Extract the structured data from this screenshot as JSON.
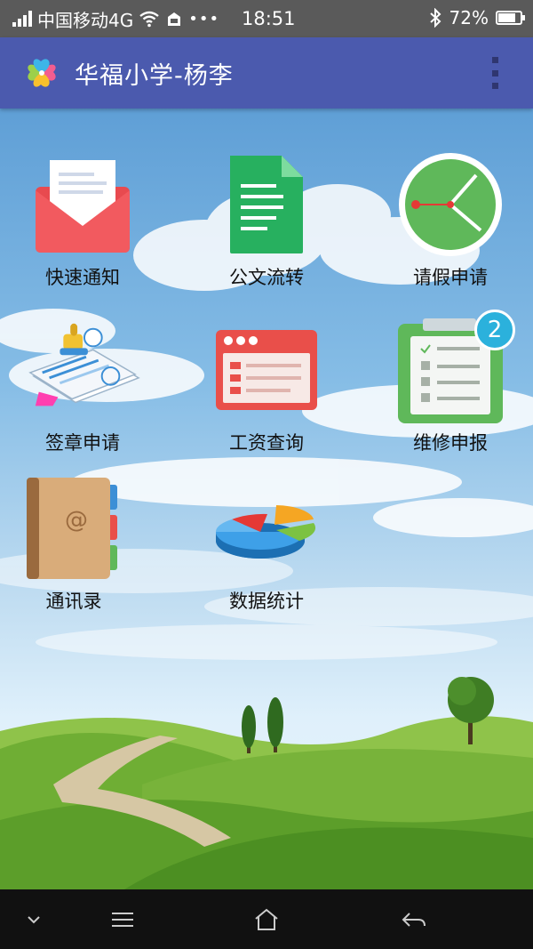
{
  "status_bar": {
    "carrier": "中国移动4G",
    "time": "18:51",
    "battery": "72%",
    "battery_level": 0.72,
    "icons": [
      "signal-icon",
      "wifi-icon",
      "sim-icon",
      "more-icon",
      "bluetooth-icon",
      "battery-icon"
    ]
  },
  "app_bar": {
    "title": "华福小学-杨李",
    "logo": "clover-logo",
    "menu_icon": "overflow-menu-icon"
  },
  "grid": [
    {
      "label": "快速通知",
      "icon": "mail-envelope-icon"
    },
    {
      "label": "公文流转",
      "icon": "document-icon"
    },
    {
      "label": "请假申请",
      "icon": "clock-icon"
    },
    {
      "label": "签章申请",
      "icon": "stamp-icon"
    },
    {
      "label": "工资查询",
      "icon": "browser-window-icon"
    },
    {
      "label": "维修申报",
      "icon": "clipboard-checklist-icon",
      "badge": "2"
    },
    {
      "label": "通讯录",
      "icon": "address-book-icon"
    },
    {
      "label": "数据统计",
      "icon": "pie-chart-icon"
    }
  ],
  "nav_bar": {
    "buttons": [
      "collapse-icon",
      "menu-icon",
      "home-icon",
      "back-icon"
    ]
  },
  "colors": {
    "status_bar_bg": "#5a5a5a",
    "app_bar_bg": "#4b5aae",
    "badge": "#2bb1dc",
    "nav_bar_bg": "#111111"
  }
}
